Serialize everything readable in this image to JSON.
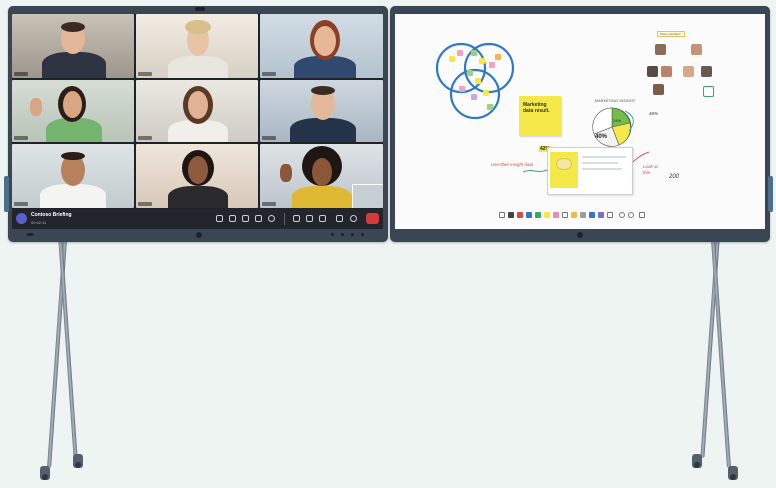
{
  "meeting": {
    "title": "Contoso Briefing",
    "subtitle": "00:42:11"
  },
  "whiteboard": {
    "sticky_note": "Marketing data result.",
    "chart_title": "MARKETING INSIGHT",
    "pie_label": "40%",
    "pie_small_label": "24%",
    "arrow_label": "42%",
    "left_note": "Use their insight data",
    "right_note": "Look at this",
    "scribble_200": "200",
    "scribble_left": "46%",
    "frame_label": "Team members"
  },
  "colors": {
    "bezel": "#3b4654",
    "toolbar": "#22262c",
    "end_call": "#d43a3a",
    "sticky_yellow": "#f5e94a",
    "venn_blue": "#2f78c8"
  }
}
